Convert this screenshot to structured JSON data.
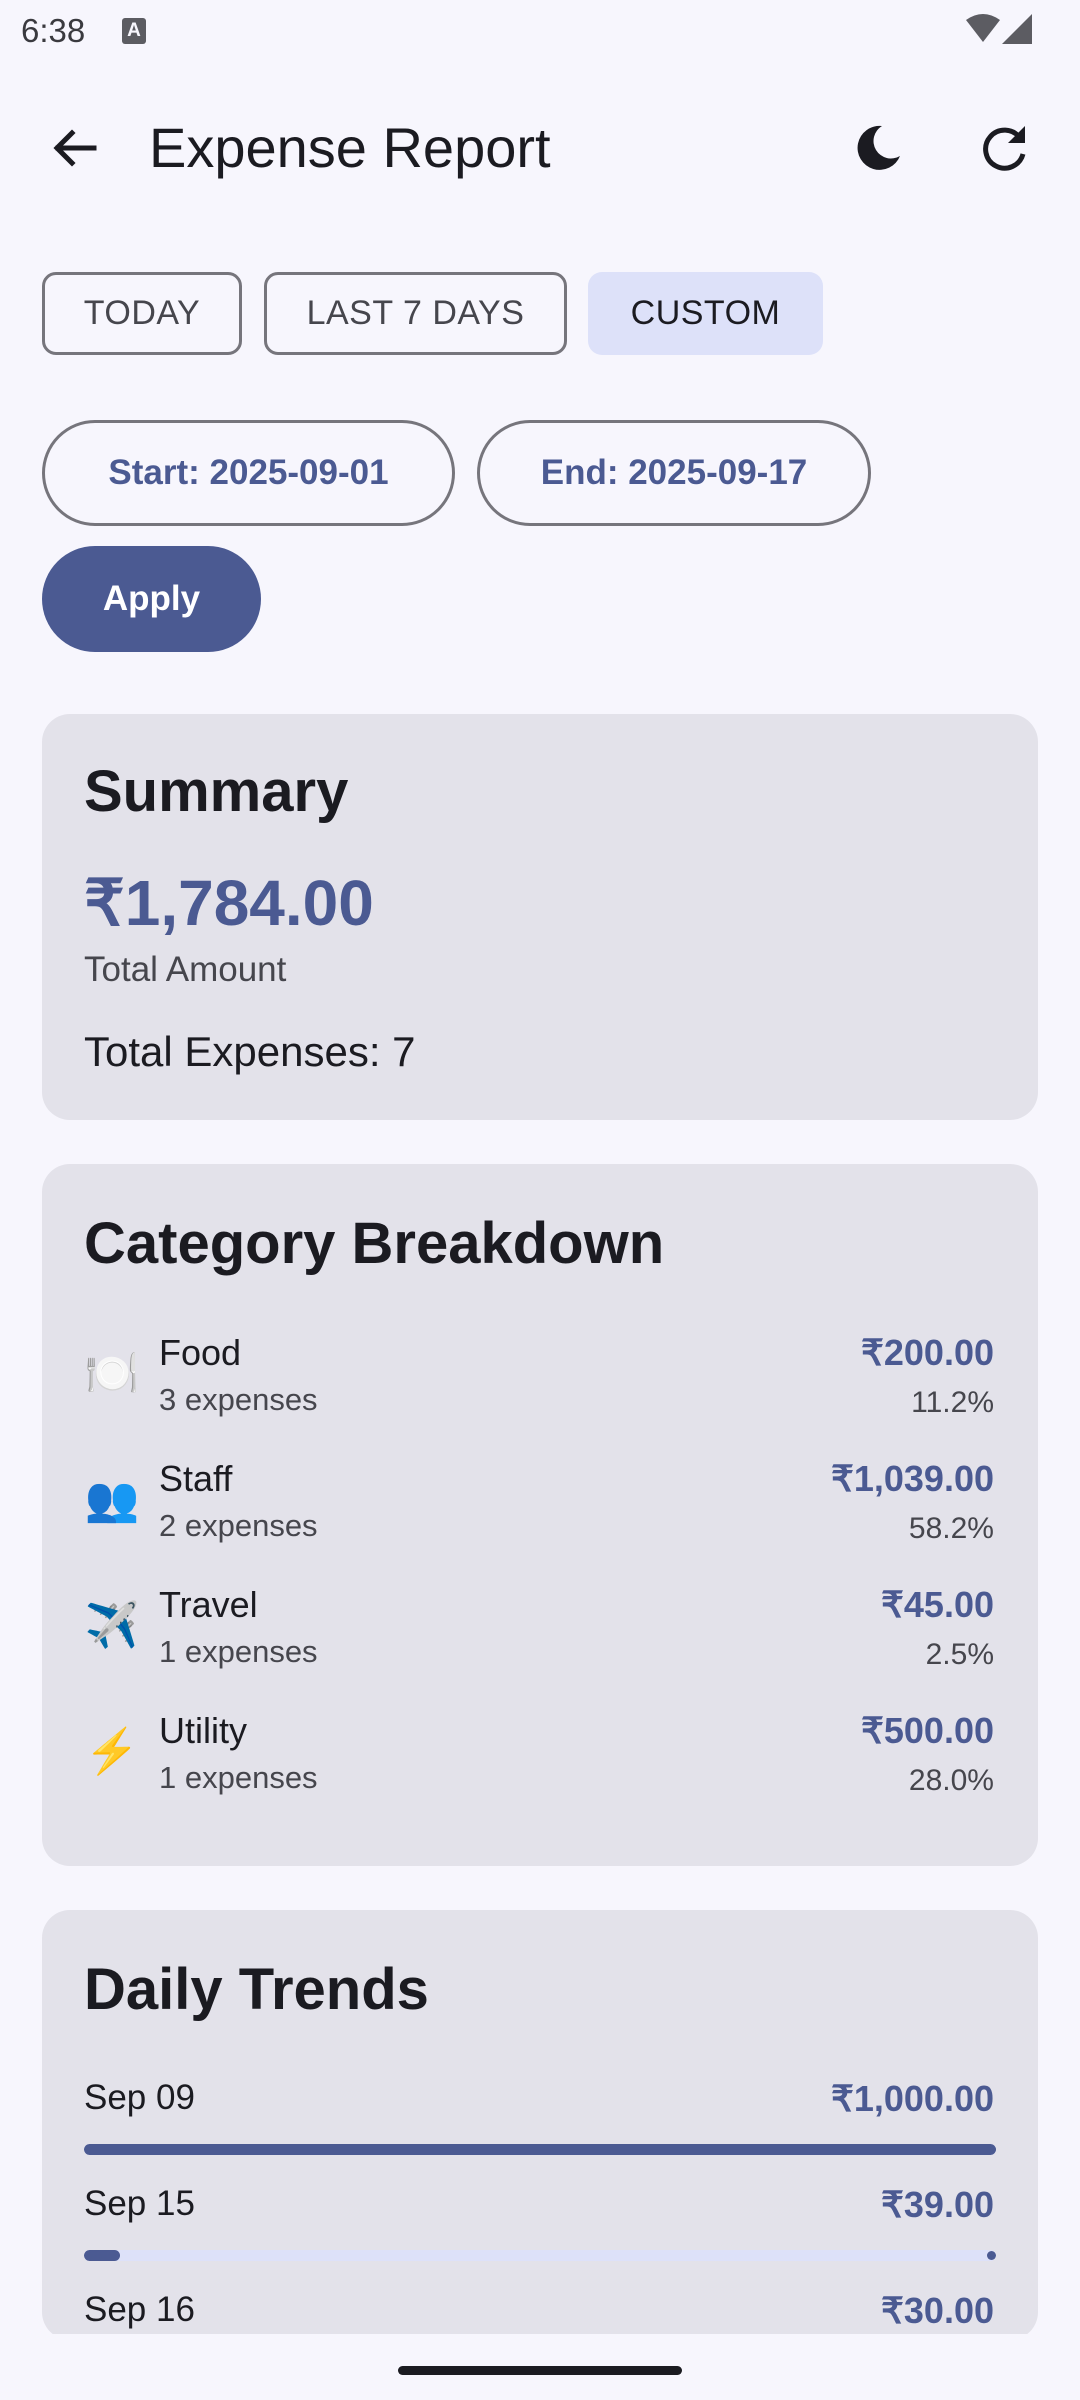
{
  "status_bar": {
    "time": "6:38",
    "notification_icon": "A"
  },
  "app_bar": {
    "title": "Expense Report",
    "back_icon": "arrow-back-icon",
    "theme_icon": "moon-icon",
    "refresh_icon": "refresh-icon"
  },
  "filters": {
    "chips": [
      {
        "label": "TODAY",
        "selected": false
      },
      {
        "label": "LAST 7 DAYS",
        "selected": false
      },
      {
        "label": "CUSTOM",
        "selected": true
      }
    ],
    "start_label": "Start: 2025-09-01",
    "end_label": "End: 2025-09-17",
    "apply_label": "Apply"
  },
  "summary": {
    "title": "Summary",
    "total_amount": "₹1,784.00",
    "total_amount_label": "Total Amount",
    "total_expenses": "Total Expenses: 7"
  },
  "category_breakdown": {
    "title": "Category Breakdown",
    "items": [
      {
        "icon": "🍽️",
        "name": "Food",
        "count": "3 expenses",
        "amount": "₹200.00",
        "percent": "11.2%"
      },
      {
        "icon": "👥",
        "name": "Staff",
        "count": "2 expenses",
        "amount": "₹1,039.00",
        "percent": "58.2%"
      },
      {
        "icon": "✈️",
        "name": "Travel",
        "count": "1 expenses",
        "amount": "₹45.00",
        "percent": "2.5%"
      },
      {
        "icon": "⚡",
        "name": "Utility",
        "count": "1 expenses",
        "amount": "₹500.00",
        "percent": "28.0%"
      }
    ]
  },
  "daily_trends": {
    "title": "Daily Trends",
    "items": [
      {
        "date": "Sep 09",
        "amount": "₹1,000.00",
        "fraction": 1.0
      },
      {
        "date": "Sep 15",
        "amount": "₹39.00",
        "fraction": 0.039
      },
      {
        "date": "Sep 16",
        "amount": "₹30.00",
        "fraction": 0.03
      }
    ]
  },
  "colors": {
    "primary": "#4b5a92",
    "card": "#e3e2ea",
    "background": "#f7f6fd",
    "chip_selected": "#dde1f9"
  }
}
